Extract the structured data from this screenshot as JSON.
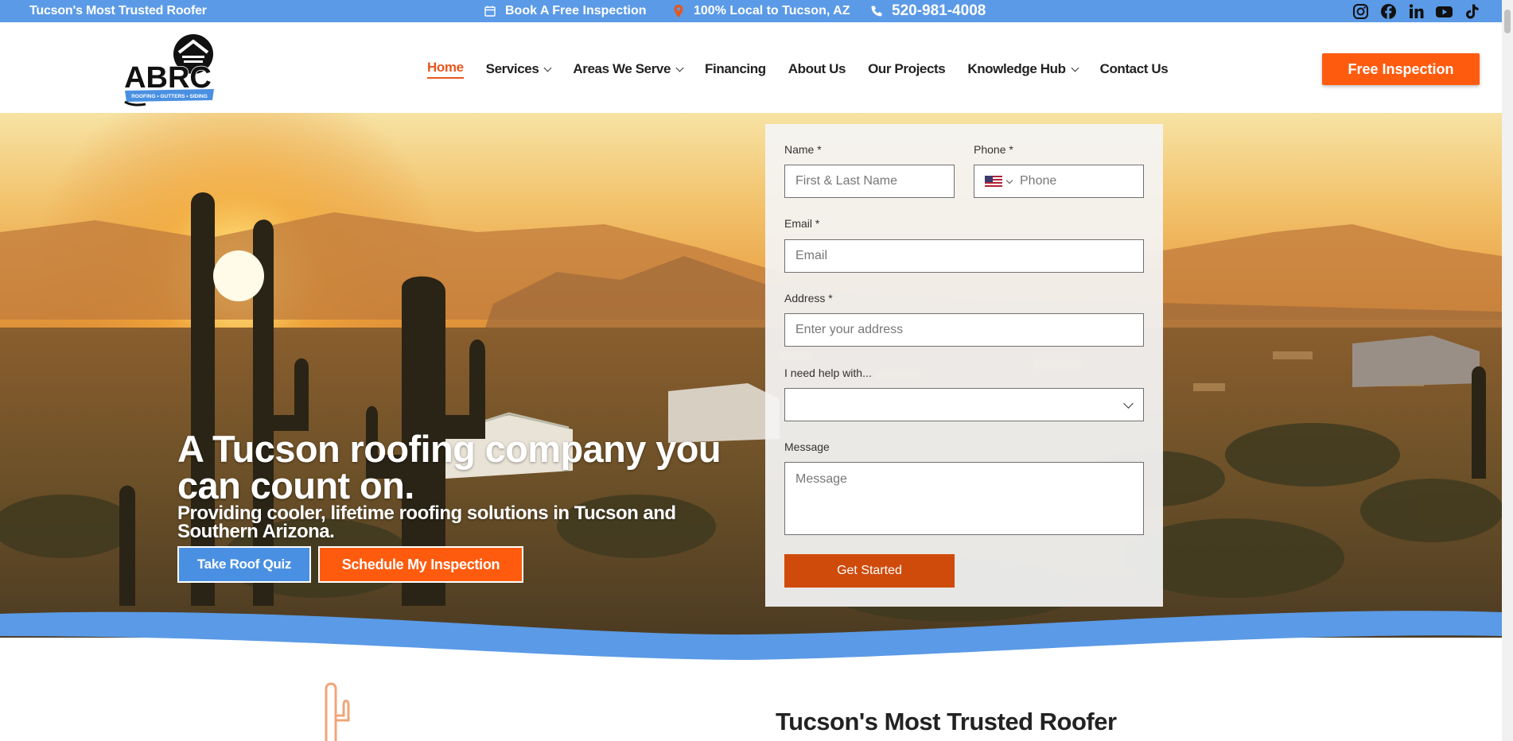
{
  "topbar": {
    "tagline": "Tucson's Most Trusted Roofer",
    "book": "Book A Free Inspection",
    "local": "100% Local to Tucson, AZ",
    "phone": "520-981-4008",
    "socials": [
      "instagram-icon",
      "facebook-icon",
      "linkedin-icon",
      "youtube-icon",
      "tiktok-icon"
    ]
  },
  "header": {
    "logo_text": "ABRC",
    "logo_ribbon": "ROOFING • GUTTERS • SIDING",
    "nav": [
      {
        "label": "Home",
        "active": true,
        "dropdown": false
      },
      {
        "label": "Services",
        "active": false,
        "dropdown": true
      },
      {
        "label": "Areas We Serve",
        "active": false,
        "dropdown": true
      },
      {
        "label": "Financing",
        "active": false,
        "dropdown": false
      },
      {
        "label": "About Us",
        "active": false,
        "dropdown": false
      },
      {
        "label": "Our Projects",
        "active": false,
        "dropdown": false
      },
      {
        "label": "Knowledge Hub",
        "active": false,
        "dropdown": true
      },
      {
        "label": "Contact Us",
        "active": false,
        "dropdown": false
      }
    ],
    "cta": "Free Inspection"
  },
  "hero": {
    "title": "A Tucson roofing company you can count on.",
    "subtitle": "Providing cooler, lifetime roofing solutions in Tucson and Southern Arizona.",
    "quiz_button": "Take Roof Quiz",
    "schedule_button": "Schedule My Inspection"
  },
  "form": {
    "name_label": "Name *",
    "name_placeholder": "First & Last Name",
    "phone_label": "Phone *",
    "phone_placeholder": "Phone",
    "email_label": "Email *",
    "email_placeholder": "Email",
    "address_label": "Address *",
    "address_placeholder": "Enter your address",
    "help_label": "I need help with...",
    "help_value": "",
    "message_label": "Message",
    "message_placeholder": "Message",
    "submit": "Get Started"
  },
  "section": {
    "title": "Tucson's Most Trusted Roofer"
  },
  "colors": {
    "brand_blue": "#5b9ae6",
    "brand_orange": "#ff5b0f",
    "submit_orange": "#cf4b0c"
  }
}
